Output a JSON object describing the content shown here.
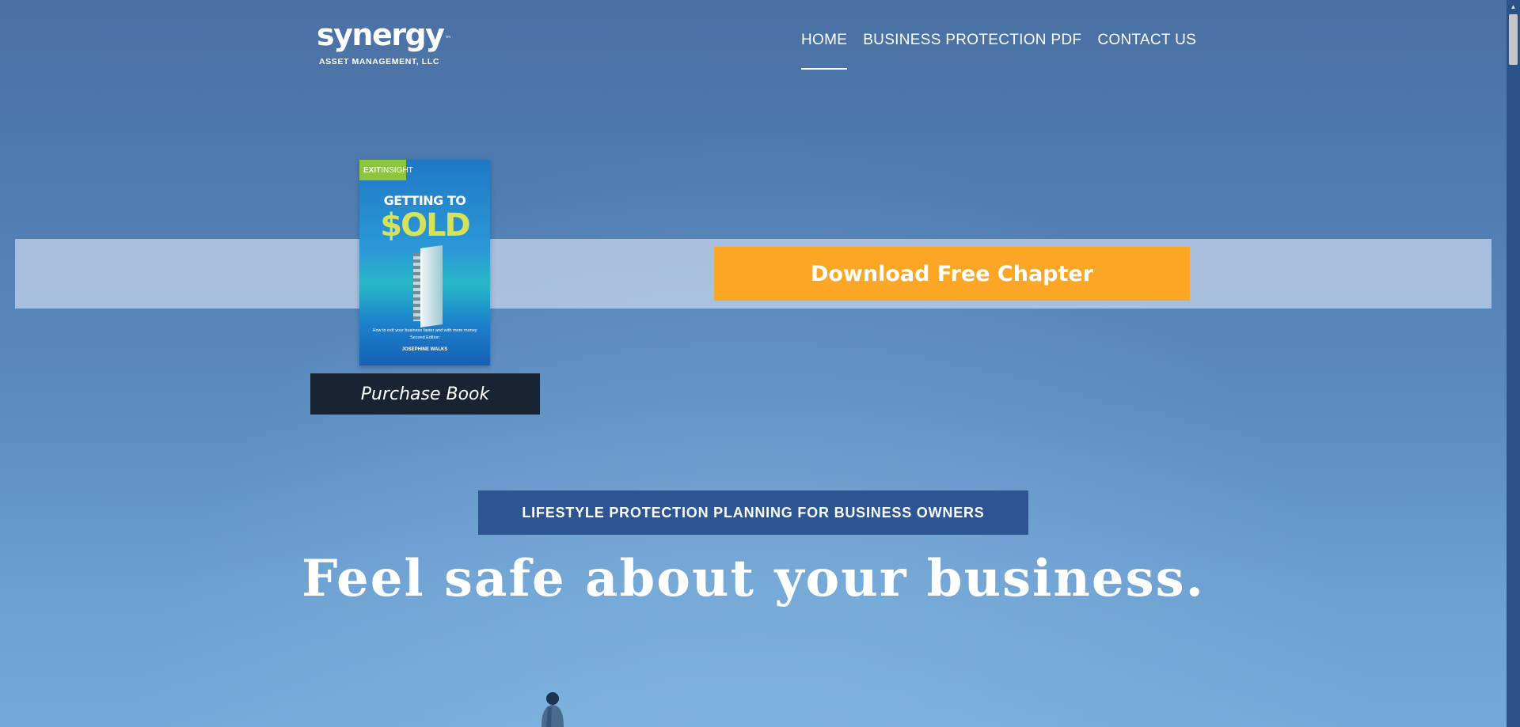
{
  "header": {
    "logo_word": "synergy",
    "logo_tm": "™",
    "logo_sub": "ASSET MANAGEMENT, LLC",
    "nav": [
      {
        "label": "HOME",
        "active": true
      },
      {
        "label": "BUSINESS PROTECTION PDF",
        "active": false
      },
      {
        "label": "CONTACT US",
        "active": false
      }
    ]
  },
  "banner": {
    "download_label": "Download Free Chapter",
    "purchase_label": "Purchase Book",
    "book": {
      "tag_bold": "EXIT",
      "tag_rest": "INSIGHT",
      "title_line1": "GETTING TO",
      "title_line2": "$OLD",
      "subtitle": "How to exit your business faster and with more money",
      "edition": "Second Edition",
      "author": "JOSEPHINE WALKS"
    }
  },
  "hero": {
    "tagline": "LIFESTYLE PROTECTION PLANNING FOR BUSINESS OWNERS",
    "headline": "Feel safe about your business."
  },
  "colors": {
    "accent_orange": "#fba624",
    "nav_dark": "#1a2333",
    "tagline_blue": "#2c5591"
  },
  "icons": {
    "scroll_up": "scroll-up-arrow-icon"
  }
}
